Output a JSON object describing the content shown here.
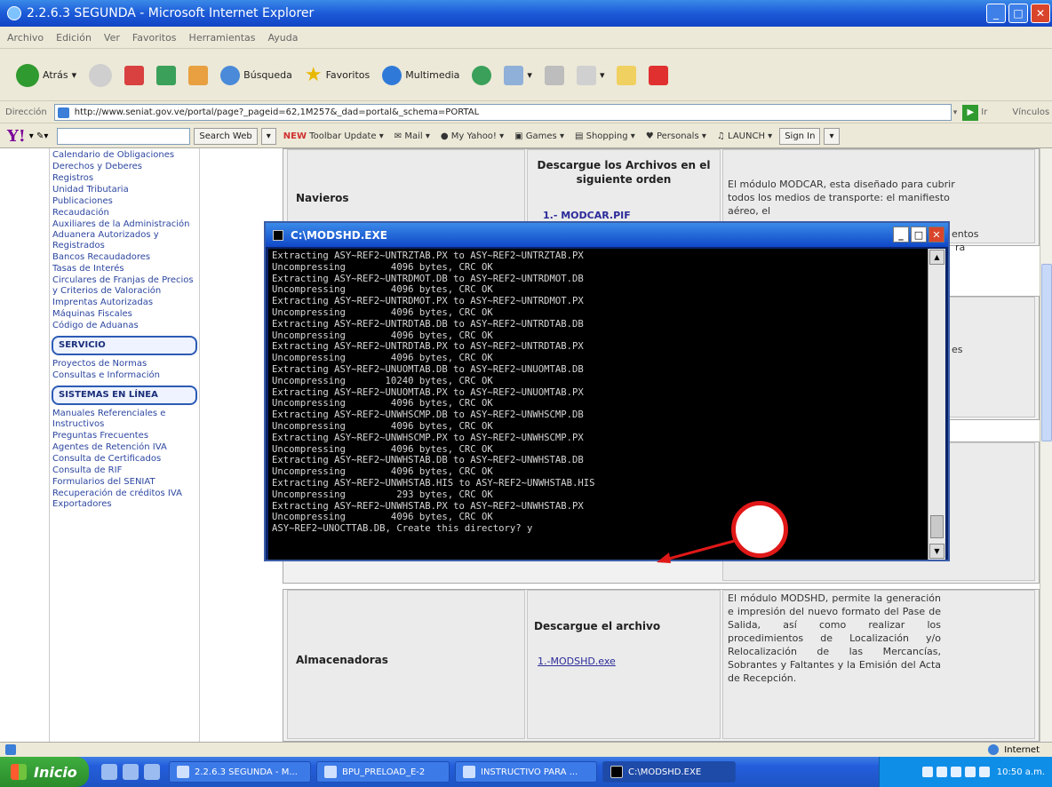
{
  "window": {
    "title": "2.2.6.3 SEGUNDA - Microsoft Internet Explorer"
  },
  "menu": [
    "Archivo",
    "Edición",
    "Ver",
    "Favoritos",
    "Herramientas",
    "Ayuda"
  ],
  "toolbar": {
    "back": "Atrás",
    "search": "Búsqueda",
    "favorites": "Favoritos",
    "multimedia": "Multimedia"
  },
  "address": {
    "label": "Dirección",
    "url": "http://www.seniat.gov.ve/portal/page?_pageid=62,1M257&_dad=portal&_schema=PORTAL",
    "go": "Ir",
    "links": "Vínculos"
  },
  "yahoo": {
    "search": "Search Web",
    "toolbar_update": "Toolbar Update",
    "mail": "Mail",
    "my_yahoo": "My Yahoo!",
    "games": "Games",
    "shopping": "Shopping",
    "personals": "Personals",
    "launch": "LAUNCH",
    "signin": "Sign In"
  },
  "sidebar": {
    "items1": [
      "Calendario de Obligaciones",
      "Derechos y Deberes",
      "Registros",
      "Unidad Tributaria",
      "Publicaciones",
      "Recaudación",
      "Auxiliares de la Administración Aduanera Autorizados y Registrados",
      "Bancos Recaudadores",
      "Tasas de Interés",
      "Circulares de Franjas de Precios y Criterios de Valoración",
      "Imprentas Autorizadas",
      "Máquinas Fiscales",
      "Código de Aduanas"
    ],
    "sec1": "SERVICIO",
    "items2": [
      "Proyectos de Normas",
      "Consultas e Información"
    ],
    "sec2": "SISTEMAS EN LÍNEA",
    "items3": [
      "Manuales Referenciales e Instructivos",
      "Preguntas Frecuentes",
      "Agentes de Retención IVA",
      "Consulta de Certificados",
      "Consulta de RIF",
      "Formularios del SENIAT",
      "Recuperación de créditos IVA Exportadores"
    ]
  },
  "table1": {
    "type": "Navieros",
    "download": "Descargue los Archivos en el siguiente orden",
    "link": "1.- MODCAR.PIF",
    "desc": "El módulo MODCAR, esta diseñado para cubrir todos los medios de transporte: el manifiesto aéreo, el",
    "side1": "entos",
    "side2": "ra"
  },
  "table2": {
    "side": "es"
  },
  "table3": {
    "type": "Almacenadoras",
    "download": "Descargue el archivo",
    "link": "1.-MODSHD.exe",
    "desc": "El módulo MODSHD, permite la generación e impresión del nuevo formato del Pase de Salida, así como realizar los procedimientos de Localización y/o Relocalización de las Mercancías, Sobrantes y Faltantes y la Emisión del Acta de Recepción."
  },
  "cmd": {
    "title": "C:\\MODSHD.EXE",
    "lines": [
      "Extracting ASY~REF2~UNTRZTAB.PX to ASY~REF2~UNTRZTAB.PX",
      "Uncompressing        4096 bytes, CRC OK",
      "Extracting ASY~REF2~UNTRDMOT.DB to ASY~REF2~UNTRDMOT.DB",
      "Uncompressing        4096 bytes, CRC OK",
      "Extracting ASY~REF2~UNTRDMOT.PX to ASY~REF2~UNTRDMOT.PX",
      "Uncompressing        4096 bytes, CRC OK",
      "Extracting ASY~REF2~UNTRDTAB.DB to ASY~REF2~UNTRDTAB.DB",
      "Uncompressing        4096 bytes, CRC OK",
      "Extracting ASY~REF2~UNTRDTAB.PX to ASY~REF2~UNTRDTAB.PX",
      "Uncompressing        4096 bytes, CRC OK",
      "Extracting ASY~REF2~UNUOMTAB.DB to ASY~REF2~UNUOMTAB.DB",
      "Uncompressing       10240 bytes, CRC OK",
      "Extracting ASY~REF2~UNUOMTAB.PX to ASY~REF2~UNUOMTAB.PX",
      "Uncompressing        4096 bytes, CRC OK",
      "Extracting ASY~REF2~UNWHSCMP.DB to ASY~REF2~UNWHSCMP.DB",
      "Uncompressing        4096 bytes, CRC OK",
      "Extracting ASY~REF2~UNWHSCMP.PX to ASY~REF2~UNWHSCMP.PX",
      "Uncompressing        4096 bytes, CRC OK",
      "Extracting ASY~REF2~UNWHSTAB.DB to ASY~REF2~UNWHSTAB.DB",
      "Uncompressing        4096 bytes, CRC OK",
      "Extracting ASY~REF2~UNWHSTAB.HIS to ASY~REF2~UNWHSTAB.HIS",
      "Uncompressing         293 bytes, CRC OK",
      "Extracting ASY~REF2~UNWHSTAB.PX to ASY~REF2~UNWHSTAB.PX",
      "Uncompressing        4096 bytes, CRC OK",
      "ASY~REF2~UNOCTTAB.DB, Create this directory? y"
    ]
  },
  "status": {
    "zone": "Internet"
  },
  "taskbar": {
    "start": "Inicio",
    "tasks": [
      "2.2.6.3 SEGUNDA - M...",
      "BPU_PRELOAD_E-2",
      "INSTRUCTIVO PARA ...",
      "C:\\MODSHD.EXE"
    ],
    "clock": "10:50 a.m."
  },
  "colors": {
    "accent": "#245edb",
    "highlight": "#e01818"
  }
}
